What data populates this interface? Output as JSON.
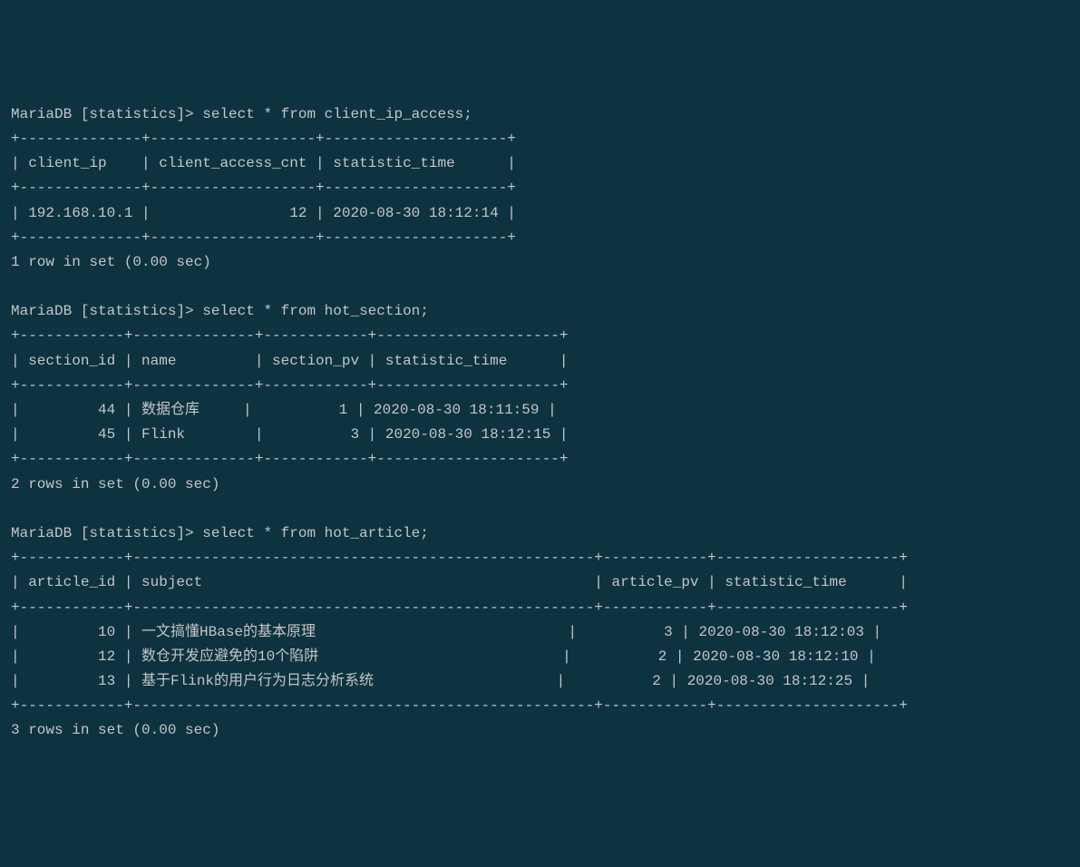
{
  "queries": [
    {
      "prompt": "MariaDB [statistics]> ",
      "cmd": "select * from client_ip_access;",
      "sep": "+--------------+-------------------+---------------------+",
      "header": "| client_ip    | client_access_cnt | statistic_time      |",
      "rows": [
        "| 192.168.10.1 |                12 | 2020-08-30 18:12:14 |"
      ],
      "footer": "1 row in set (0.00 sec)"
    },
    {
      "prompt": "MariaDB [statistics]> ",
      "cmd": "select * from hot_section;",
      "sep": "+------------+--------------+------------+---------------------+",
      "header": "| section_id | name         | section_pv | statistic_time      |",
      "rows": [
        "|         44 | 数据仓库     |          1 | 2020-08-30 18:11:59 |",
        "|         45 | Flink        |          3 | 2020-08-30 18:12:15 |"
      ],
      "footer": "2 rows in set (0.00 sec)"
    },
    {
      "prompt": "MariaDB [statistics]> ",
      "cmd": "select * from hot_article;",
      "sep": "+------------+-----------------------------------------------------+------------+---------------------+",
      "header": "| article_id | subject                                             | article_pv | statistic_time      |",
      "rows": [
        "|         10 | 一文搞懂HBase的基本原理                             |          3 | 2020-08-30 18:12:03 |",
        "|         12 | 数仓开发应避免的10个陷阱                            |          2 | 2020-08-30 18:12:10 |",
        "|         13 | 基于Flink的用户行为日志分析系统                     |          2 | 2020-08-30 18:12:25 |"
      ],
      "footer": "3 rows in set (0.00 sec)"
    }
  ]
}
